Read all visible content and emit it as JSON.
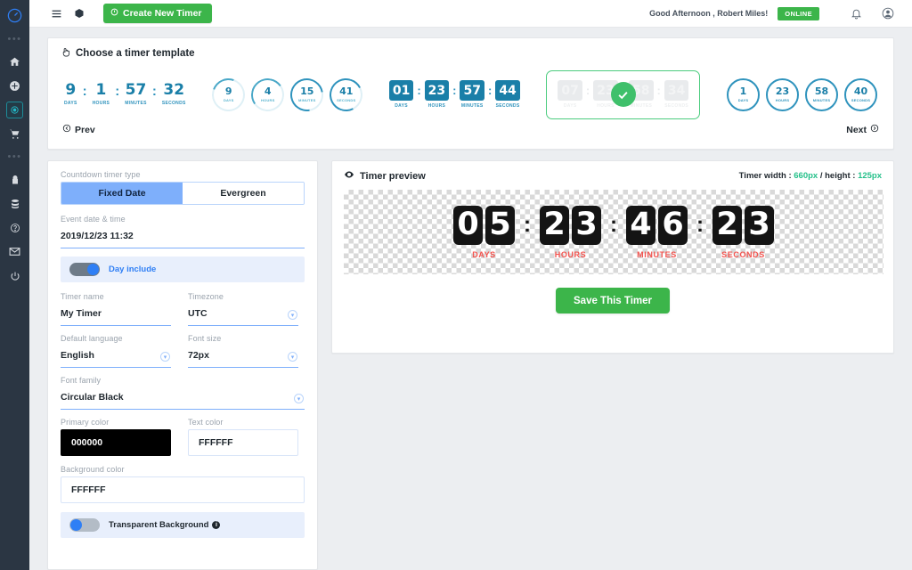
{
  "sidebar": {
    "logo_icon": "stopwatch-icon",
    "items": [
      {
        "icon": "dots-icon",
        "type": "divider"
      },
      {
        "icon": "home-icon",
        "name": "home"
      },
      {
        "icon": "plus-circle-icon",
        "name": "add"
      },
      {
        "icon": "timer-target-icon",
        "name": "timers",
        "active": true
      },
      {
        "icon": "cart-icon",
        "name": "shop"
      },
      {
        "icon": "dots-icon",
        "type": "divider"
      },
      {
        "icon": "lock-icon",
        "name": "security"
      },
      {
        "icon": "database-icon",
        "name": "database"
      },
      {
        "icon": "help-circle-icon",
        "name": "help"
      },
      {
        "icon": "envelope-icon",
        "name": "messages"
      },
      {
        "icon": "power-icon",
        "name": "logout"
      }
    ]
  },
  "topbar": {
    "menu_icon": "hamburger-icon",
    "box_icon": "cube-icon",
    "create_button": "Create New Timer",
    "create_icon": "clock-plus-icon",
    "greeting": "Good Afternoon , Robert Miles!",
    "status_badge": "ONLINE",
    "bell_icon": "bell-icon",
    "avatar_icon": "user-avatar-icon"
  },
  "templates": {
    "heading": "Choose a timer template",
    "heading_icon": "hand-pointer-icon",
    "prev_label": "Prev",
    "next_label": "Next",
    "prev_icon": "arrow-left-circle-icon",
    "next_icon": "arrow-right-circle-icon",
    "items": [
      {
        "style": "plain",
        "selected": false,
        "units": [
          {
            "value": "9",
            "label": "DAYS"
          },
          {
            "value": "1",
            "label": "HOURS"
          },
          {
            "value": "57",
            "label": "MINUTES"
          },
          {
            "value": "32",
            "label": "SECONDS"
          }
        ]
      },
      {
        "style": "circles-light",
        "selected": false,
        "units": [
          {
            "value": "9",
            "label": "DAYS"
          },
          {
            "value": "4",
            "label": "HOURS"
          },
          {
            "value": "15",
            "label": "MINUTES"
          },
          {
            "value": "41",
            "label": "SECONDS"
          }
        ]
      },
      {
        "style": "tiles",
        "selected": false,
        "units": [
          {
            "value": "01",
            "label": "DAYS"
          },
          {
            "value": "23",
            "label": "HOURS"
          },
          {
            "value": "57",
            "label": "MINUTES"
          },
          {
            "value": "44",
            "label": "SECONDS"
          }
        ]
      },
      {
        "style": "tiles",
        "selected": true,
        "units": [
          {
            "value": "07",
            "label": "DAYS"
          },
          {
            "value": "23",
            "label": "HOURS"
          },
          {
            "value": "58",
            "label": "MINUTES"
          },
          {
            "value": "34",
            "label": "SECONDS"
          }
        ]
      },
      {
        "style": "circles-dark",
        "selected": false,
        "units": [
          {
            "value": "1",
            "label": "DAYS"
          },
          {
            "value": "23",
            "label": "HOURS"
          },
          {
            "value": "58",
            "label": "MINUTES"
          },
          {
            "value": "40",
            "label": "SECONDS"
          }
        ]
      }
    ]
  },
  "form": {
    "timer_type_label": "Countdown timer type",
    "type_fixed": "Fixed Date",
    "type_evergreen": "Evergreen",
    "type_selected": "Fixed Date",
    "event_date_label": "Event date & time",
    "event_date_value": "2019/12/23 11:32",
    "day_include_label": "Day include",
    "day_include_on": true,
    "timer_name_label": "Timer name",
    "timer_name_value": "My Timer",
    "timezone_label": "Timezone",
    "timezone_value": "UTC",
    "language_label": "Default language",
    "language_value": "English",
    "font_size_label": "Font size",
    "font_size_value": "72px",
    "font_family_label": "Font family",
    "font_family_value": "Circular Black",
    "primary_color_label": "Primary color",
    "primary_color_value": "000000",
    "text_color_label": "Text color",
    "text_color_value": "FFFFFF",
    "background_color_label": "Background color",
    "background_color_value": "FFFFFF",
    "transparent_bg_label": "Transparent Background",
    "transparent_bg_on": false,
    "info_icon": "info-icon",
    "caret_icon": "chevron-down-icon"
  },
  "preview": {
    "title": "Timer preview",
    "title_icon": "eye-icon",
    "dims_prefix": "Timer width : ",
    "width_value": "660px",
    "dims_mid": " / height : ",
    "height_value": "125px",
    "save_label": "Save This Timer",
    "units": [
      {
        "digits": [
          "0",
          "5"
        ],
        "label": "DAYS"
      },
      {
        "digits": [
          "2",
          "3"
        ],
        "label": "HOURS"
      },
      {
        "digits": [
          "4",
          "6"
        ],
        "label": "MINUTES"
      },
      {
        "digits": [
          "2",
          "3"
        ],
        "label": "SECONDS"
      }
    ]
  },
  "colors": {
    "brand_green": "#3cb54a",
    "accent_blue": "#2f7ff5",
    "template_blue": "#1a7fa8",
    "selected_green": "#4bcc7e",
    "label_red": "#f4544f",
    "dims_green": "#25c08a",
    "sidebar_bg": "#2b3643"
  }
}
